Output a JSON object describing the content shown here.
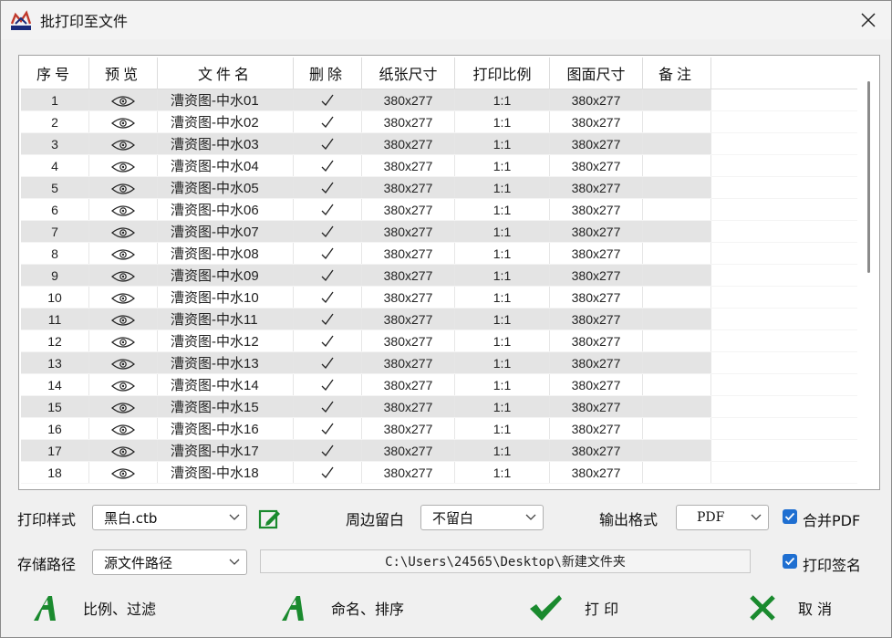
{
  "window": {
    "title": "批打印至文件",
    "logo_text": "MSteel"
  },
  "table": {
    "headers": [
      "序号",
      "预览",
      "文件名",
      "删除",
      "纸张尺寸",
      "打印比例",
      "图面尺寸",
      "备注"
    ],
    "rows": [
      {
        "no": "1",
        "name": "漕资图-中水01",
        "paper": "380x277",
        "scale": "1:1",
        "size": "380x277",
        "note": ""
      },
      {
        "no": "2",
        "name": "漕资图-中水02",
        "paper": "380x277",
        "scale": "1:1",
        "size": "380x277",
        "note": ""
      },
      {
        "no": "3",
        "name": "漕资图-中水03",
        "paper": "380x277",
        "scale": "1:1",
        "size": "380x277",
        "note": ""
      },
      {
        "no": "4",
        "name": "漕资图-中水04",
        "paper": "380x277",
        "scale": "1:1",
        "size": "380x277",
        "note": ""
      },
      {
        "no": "5",
        "name": "漕资图-中水05",
        "paper": "380x277",
        "scale": "1:1",
        "size": "380x277",
        "note": ""
      },
      {
        "no": "6",
        "name": "漕资图-中水06",
        "paper": "380x277",
        "scale": "1:1",
        "size": "380x277",
        "note": ""
      },
      {
        "no": "7",
        "name": "漕资图-中水07",
        "paper": "380x277",
        "scale": "1:1",
        "size": "380x277",
        "note": ""
      },
      {
        "no": "8",
        "name": "漕资图-中水08",
        "paper": "380x277",
        "scale": "1:1",
        "size": "380x277",
        "note": ""
      },
      {
        "no": "9",
        "name": "漕资图-中水09",
        "paper": "380x277",
        "scale": "1:1",
        "size": "380x277",
        "note": ""
      },
      {
        "no": "10",
        "name": "漕资图-中水10",
        "paper": "380x277",
        "scale": "1:1",
        "size": "380x277",
        "note": ""
      },
      {
        "no": "11",
        "name": "漕资图-中水11",
        "paper": "380x277",
        "scale": "1:1",
        "size": "380x277",
        "note": ""
      },
      {
        "no": "12",
        "name": "漕资图-中水12",
        "paper": "380x277",
        "scale": "1:1",
        "size": "380x277",
        "note": ""
      },
      {
        "no": "13",
        "name": "漕资图-中水13",
        "paper": "380x277",
        "scale": "1:1",
        "size": "380x277",
        "note": ""
      },
      {
        "no": "14",
        "name": "漕资图-中水14",
        "paper": "380x277",
        "scale": "1:1",
        "size": "380x277",
        "note": ""
      },
      {
        "no": "15",
        "name": "漕资图-中水15",
        "paper": "380x277",
        "scale": "1:1",
        "size": "380x277",
        "note": ""
      },
      {
        "no": "16",
        "name": "漕资图-中水16",
        "paper": "380x277",
        "scale": "1:1",
        "size": "380x277",
        "note": ""
      },
      {
        "no": "17",
        "name": "漕资图-中水17",
        "paper": "380x277",
        "scale": "1:1",
        "size": "380x277",
        "note": ""
      },
      {
        "no": "18",
        "name": "漕资图-中水18",
        "paper": "380x277",
        "scale": "1:1",
        "size": "380x277",
        "note": ""
      }
    ]
  },
  "options": {
    "print_style_label": "打印样式",
    "print_style_value": "黑白.ctb",
    "margin_label": "周边留白",
    "margin_value": "不留白",
    "output_format_label": "输出格式",
    "output_format_value": "PDF",
    "merge_pdf_label": "合并PDF",
    "merge_pdf_checked": true,
    "save_path_label": "存储路径",
    "save_path_value": "源文件路径",
    "path_text": "C:\\Users\\24565\\Desktop\\新建文件夹",
    "print_sign_label": "打印签名",
    "print_sign_checked": true
  },
  "buttons": {
    "scale_filter": "比例、过滤",
    "name_sort": "命名、排序",
    "print": "打 印",
    "cancel": "取 消"
  },
  "colors": {
    "accent_green": "#1a8a2e",
    "checkbox_blue": "#1f6fd1",
    "row_stripe": "#e4e4e4"
  }
}
